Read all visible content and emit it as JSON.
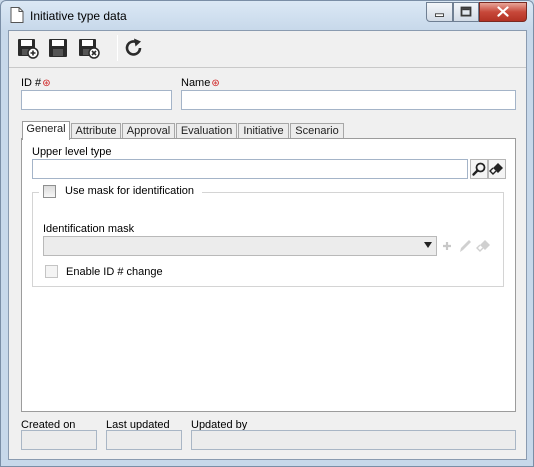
{
  "window": {
    "title": "Initiative type data",
    "controls": {
      "minimize": "minimize-icon",
      "maximize": "maximize-icon",
      "close": "close-icon"
    }
  },
  "toolbar": {
    "buttons": [
      "save-new-icon",
      "save-icon",
      "save-close-icon",
      "refresh-icon"
    ]
  },
  "fields": {
    "id_label": "ID #",
    "name_label": "Name",
    "id_value": "",
    "name_value": ""
  },
  "tabs": [
    {
      "label": "General",
      "active": true
    },
    {
      "label": "Attribute",
      "active": false
    },
    {
      "label": "Approval",
      "active": false
    },
    {
      "label": "Evaluation",
      "active": false
    },
    {
      "label": "Initiative",
      "active": false
    },
    {
      "label": "Scenario",
      "active": false
    }
  ],
  "general": {
    "upper_level_label": "Upper level type",
    "upper_level_value": "",
    "use_mask_label": "Use mask for identification",
    "use_mask_checked": false,
    "identification_mask_label": "Identification mask",
    "identification_mask_value": "",
    "enable_id_change_label": "Enable ID # change",
    "enable_id_change_checked": false
  },
  "footer": {
    "created_on_label": "Created on",
    "last_updated_label": "Last updated",
    "updated_by_label": "Updated by",
    "created_on_value": "",
    "last_updated_value": "",
    "updated_by_value": ""
  },
  "colors": {
    "title_bar": "#c7d8ea",
    "close_button": "#c7483a",
    "required_marker": "#d02020",
    "input_border": "#a4b4c8"
  }
}
